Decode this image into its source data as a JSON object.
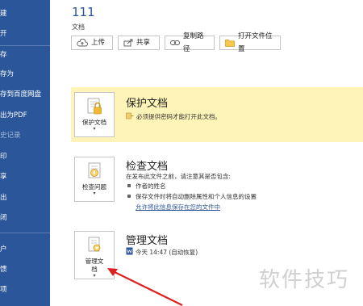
{
  "nav": {
    "items": [
      "建",
      "开",
      "存",
      "存为",
      "存到百度网盘",
      "出为PDF",
      "史记录",
      "印",
      "享",
      "出",
      "闭",
      "户",
      "馈",
      "项"
    ]
  },
  "header": {
    "title": "111",
    "path": "文档"
  },
  "toolbar": {
    "upload": "上传",
    "share": "共享",
    "copy_path": "复制路径",
    "open_location": "打开文件位置"
  },
  "protect": {
    "button_label": "保护文档",
    "title": "保护文档",
    "desc": "必须提供密码才能打开此文档。"
  },
  "inspect": {
    "button_label": "检查问题",
    "title": "检查文档",
    "desc": "在发布此文件之前，请注意其是否包含:",
    "bullet1": "作者的姓名",
    "bullet2": "保存文件时将自动删除属性和个人信息的设置",
    "link": "允许将此信息保存在您的文件中"
  },
  "manage": {
    "button_line1": "管理文",
    "button_line2": "档",
    "title": "管理文档",
    "version": "今天 14:47 (自动恢复)"
  },
  "watermark": "软件技巧",
  "colors": {
    "nav_bg": "#2b579a",
    "protect_bg": "#fff4b8",
    "arrow": "#e02020"
  }
}
